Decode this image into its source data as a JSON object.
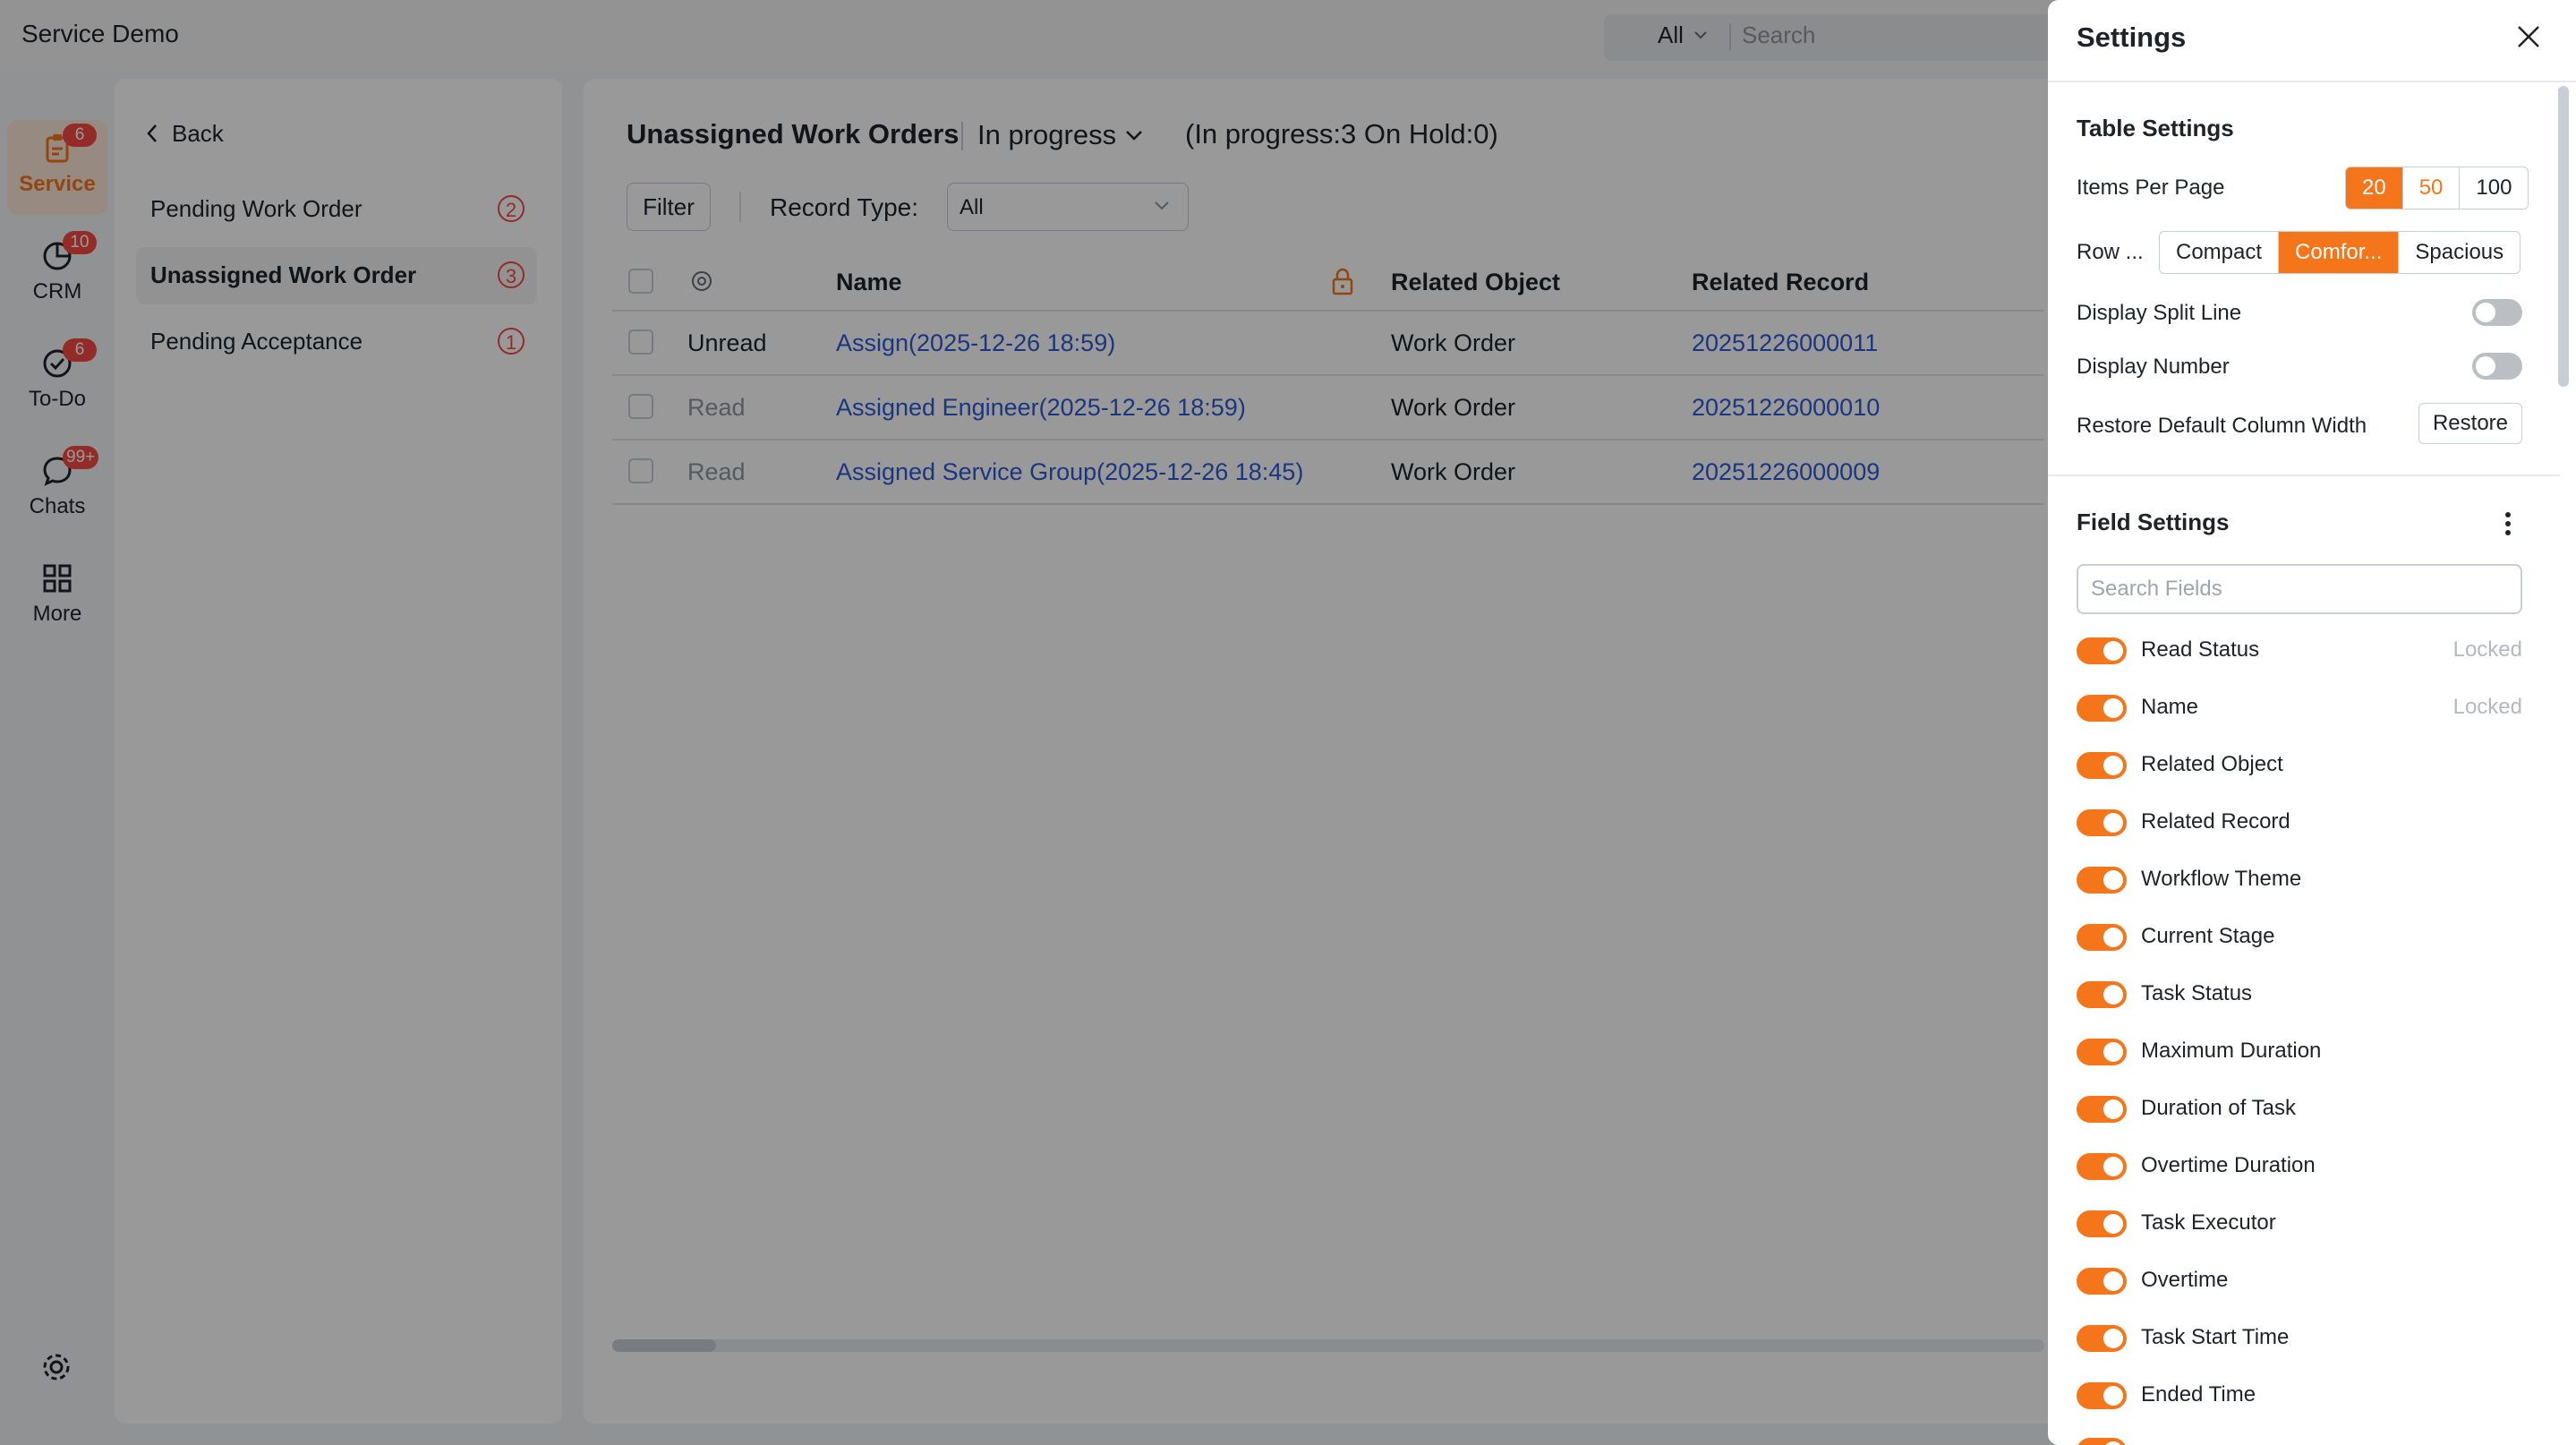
{
  "app": {
    "title": "Service Demo"
  },
  "search": {
    "scope": "All",
    "placeholder": "Search"
  },
  "rail": [
    {
      "label": "Service",
      "badge": "6",
      "icon": "service-icon",
      "active": true
    },
    {
      "label": "CRM",
      "badge": "10",
      "icon": "crm-icon"
    },
    {
      "label": "To-Do",
      "badge": "6",
      "icon": "todo-icon"
    },
    {
      "label": "Chats",
      "badge": "99+",
      "icon": "chat-icon"
    },
    {
      "label": "More",
      "badge": "",
      "icon": "grid-icon"
    }
  ],
  "nav": {
    "back": "Back",
    "items": [
      {
        "label": "Pending Work Order",
        "count": "2"
      },
      {
        "label": "Unassigned Work Order",
        "count": "3",
        "active": true
      },
      {
        "label": "Pending Acceptance",
        "count": "1"
      }
    ]
  },
  "main": {
    "title": "Unassigned Work Orders",
    "view": "In progress",
    "counts": "(In progress:3 On Hold:0)",
    "filter": "Filter",
    "record_type_label": "Record Type:",
    "record_type_value": "All",
    "columns": [
      "Name",
      "Related Object",
      "Related Record"
    ],
    "rows": [
      {
        "status": "Unread",
        "name": "Assign(2025-12-26 18:59)",
        "object": "Work Order",
        "record": "20251226000011"
      },
      {
        "status": "Read",
        "name": "Assigned Engineer(2025-12-26 18:59)",
        "object": "Work Order",
        "record": "20251226000010"
      },
      {
        "status": "Read",
        "name": "Assigned Service Group(2025-12-26 18:45)",
        "object": "Work Order",
        "record": "20251226000009"
      }
    ]
  },
  "drawer": {
    "title": "Settings",
    "table_settings": "Table Settings",
    "items_per_page_label": "Items Per Page",
    "items_per_page": [
      "20",
      "50",
      "100"
    ],
    "items_per_page_selected": "20",
    "row_label": "Row ...",
    "row_options": [
      "Compact",
      "Comfor...",
      "Spacious"
    ],
    "row_selected": "Comfor...",
    "display_split_line": "Display Split Line",
    "display_number": "Display Number",
    "restore_label": "Restore Default Column Width",
    "restore_button": "Restore",
    "field_settings": "Field Settings",
    "search_fields_placeholder": "Search Fields",
    "locked_label": "Locked",
    "fields": [
      {
        "name": "Read Status",
        "locked": true
      },
      {
        "name": "Name",
        "locked": true
      },
      {
        "name": "Related Object"
      },
      {
        "name": "Related Record"
      },
      {
        "name": "Workflow Theme"
      },
      {
        "name": "Current Stage"
      },
      {
        "name": "Task Status"
      },
      {
        "name": "Maximum Duration"
      },
      {
        "name": "Duration of Task"
      },
      {
        "name": "Overtime Duration"
      },
      {
        "name": "Task Executor"
      },
      {
        "name": "Overtime"
      },
      {
        "name": "Task Start Time"
      },
      {
        "name": "Ended Time"
      }
    ]
  },
  "colors": {
    "accent": "#f5761a",
    "link": "#2d5bd5",
    "badge": "#f54a45"
  }
}
